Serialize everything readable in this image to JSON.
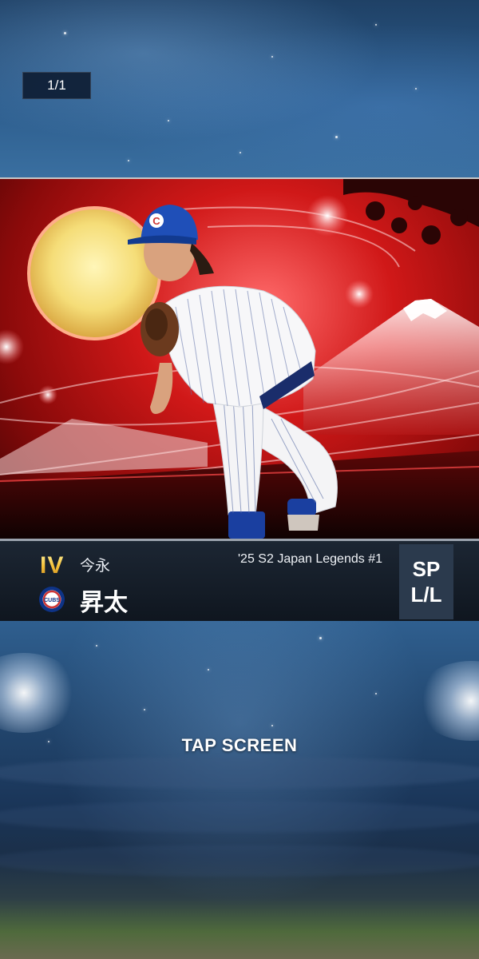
{
  "page_counter": "1/1",
  "card": {
    "tier": "IV",
    "last_name": "今永",
    "first_name": "昇太",
    "series": "'25 S2 Japan Legends #1",
    "position": "SP",
    "bats_throws": "L/L",
    "team_logo_icon": "cubs-logo-icon",
    "team_logo_text": "CUBS",
    "cap_letter": "C"
  },
  "prompt": "TAP SCREEN",
  "colors": {
    "tier_gold": "#f5c23a",
    "card_red": "#d01818",
    "info_bar": "#0f161f",
    "pos_box": "#2b3a4d",
    "cubs_blue": "#0e3386",
    "cubs_red": "#cc3433"
  }
}
